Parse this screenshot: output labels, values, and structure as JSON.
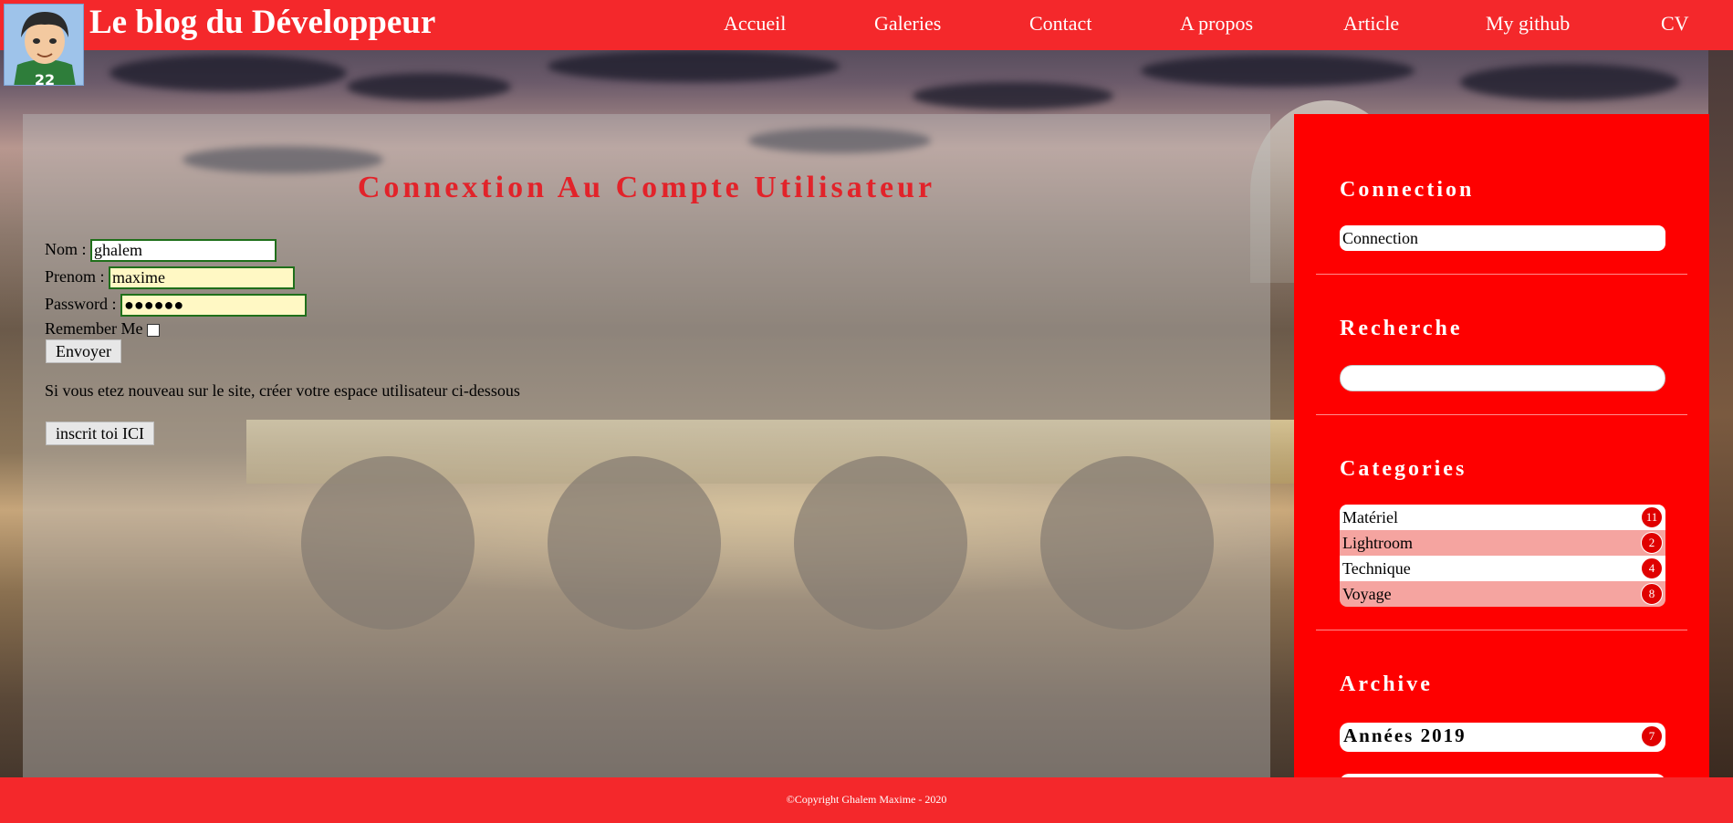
{
  "header": {
    "brand": "Le blog du Développeur",
    "nav": [
      "Accueil",
      "Galeries",
      "Contact",
      "A propos",
      "Article",
      "My github",
      "CV"
    ]
  },
  "login": {
    "title": "Connextion Au Compte Utilisateur",
    "nom_label": "Nom :",
    "nom_value": "ghalem",
    "prenom_label": "Prenom :",
    "prenom_value": "maxime",
    "password_label": "Password :",
    "password_value": "●●●●●●",
    "remember_label": "Remember Me",
    "submit_label": "Envoyer",
    "info_text": "Si vous etez nouveau sur le site, créer votre espace utilisateur ci-dessous",
    "register_label": "inscrit toi ICI"
  },
  "sidebar": {
    "connection_title": "Connection",
    "connection_link": "Connection",
    "search_title": "Recherche",
    "search_value": "",
    "categories_title": "Categories",
    "categories": [
      {
        "label": "Matériel",
        "count": "11"
      },
      {
        "label": "Lightroom",
        "count": "2"
      },
      {
        "label": "Technique",
        "count": "4"
      },
      {
        "label": "Voyage",
        "count": "8"
      }
    ],
    "archive_title": "Archive",
    "archive_label": "Années 2019",
    "archive_count": "7"
  },
  "footer": {
    "copyright": "©Copyright Ghalem Maxime - 2020"
  },
  "colors": {
    "header_red": "#f4282b",
    "sidebar_red": "#fe0000",
    "title_red": "#e2232a",
    "input_border": "#1f6f1a",
    "autofill_bg": "#fff8c4"
  }
}
